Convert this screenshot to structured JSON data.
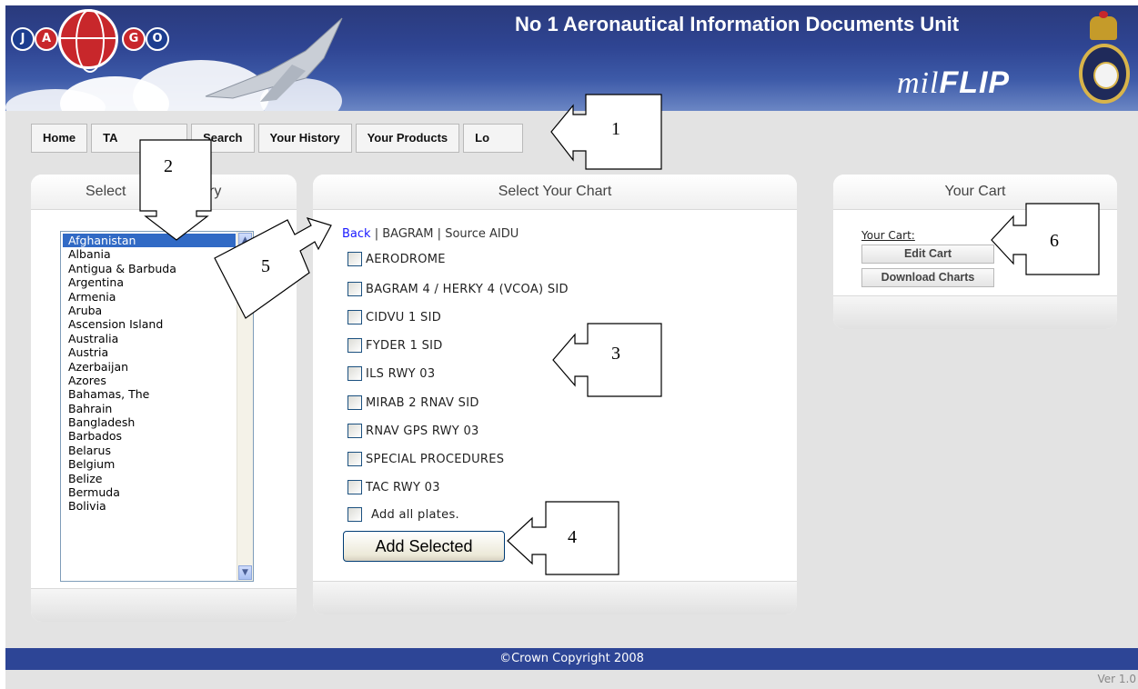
{
  "header": {
    "logo_letters": [
      "J",
      "A",
      "G",
      "O"
    ],
    "title": "No 1 Aeronautical Information Documents Unit",
    "brand": "milFLIP",
    "brand_prefix": "mil",
    "brand_suffix": "FLIP",
    "icons": [
      "jago-globe-logo",
      "typhoon-jet-image",
      "royal-crest-badge"
    ]
  },
  "nav": {
    "tabs": [
      "Home",
      "TA",
      "Search",
      "Your History",
      "Your Products",
      "Lo"
    ]
  },
  "country_panel": {
    "title_left": "Select",
    "title_right": "ry",
    "countries": [
      "Afghanistan",
      "Albania",
      "Antigua & Barbuda",
      "Argentina",
      "Armenia",
      "Aruba",
      "Ascension Island",
      "Australia",
      "Austria",
      "Azerbaijan",
      "Azores",
      "Bahamas, The",
      "Bahrain",
      "Bangladesh",
      "Barbados",
      "Belarus",
      "Belgium",
      "Belize",
      "Bermuda",
      "Bolivia"
    ],
    "selected": "Afghanistan"
  },
  "chart_panel": {
    "title": "Select Your Chart",
    "back_label": "Back",
    "airport": "BAGRAM",
    "source": "Source AIDU",
    "separator": "|",
    "charts": [
      "AERODROME",
      "BAGRAM 4 / HERKY 4 (VCOA) SID",
      "CIDVU 1 SID",
      "FYDER 1 SID",
      "ILS RWY 03",
      "MIRAB 2 RNAV SID",
      "RNAV GPS RWY 03",
      "SPECIAL PROCEDURES",
      "TAC RWY 03"
    ],
    "add_all_label": "Add all plates.",
    "add_selected_label": "Add Selected"
  },
  "cart_panel": {
    "title": "Your Cart",
    "cart_label": "Your Cart:",
    "edit_cart_label": "Edit Cart",
    "download_label": "Download Charts"
  },
  "footer": {
    "copyright": "©Crown Copyright 2008",
    "version": "Ver 1.0"
  },
  "annotations": [
    "1",
    "2",
    "3",
    "4",
    "5",
    "6"
  ],
  "colors": {
    "banner": "#2f4593",
    "footer": "#2d4596",
    "selection": "#316ac5",
    "link": "#1a1aff"
  }
}
